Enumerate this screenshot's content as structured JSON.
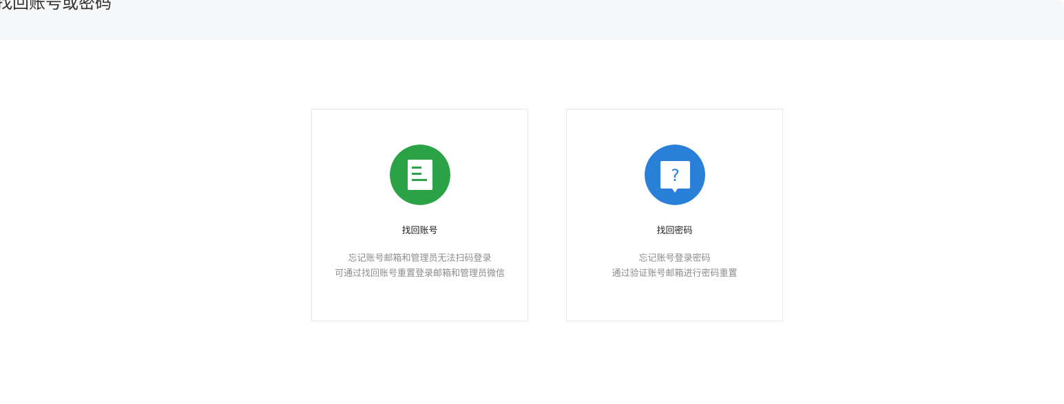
{
  "header": {
    "title": "找回账号或密码"
  },
  "cards": [
    {
      "title": "找回账号",
      "desc_line1": "忘记账号邮箱和管理员无法扫码登录",
      "desc_line2": "可通过找回账号重置登录邮箱和管理员微信",
      "icon": "document-icon",
      "color": "#2ba245"
    },
    {
      "title": "找回密码",
      "desc_line1": "忘记账号登录密码",
      "desc_line2": "通过验证账号邮箱进行密码重置",
      "icon": "question-bubble-icon",
      "color": "#2a7fd8"
    }
  ]
}
